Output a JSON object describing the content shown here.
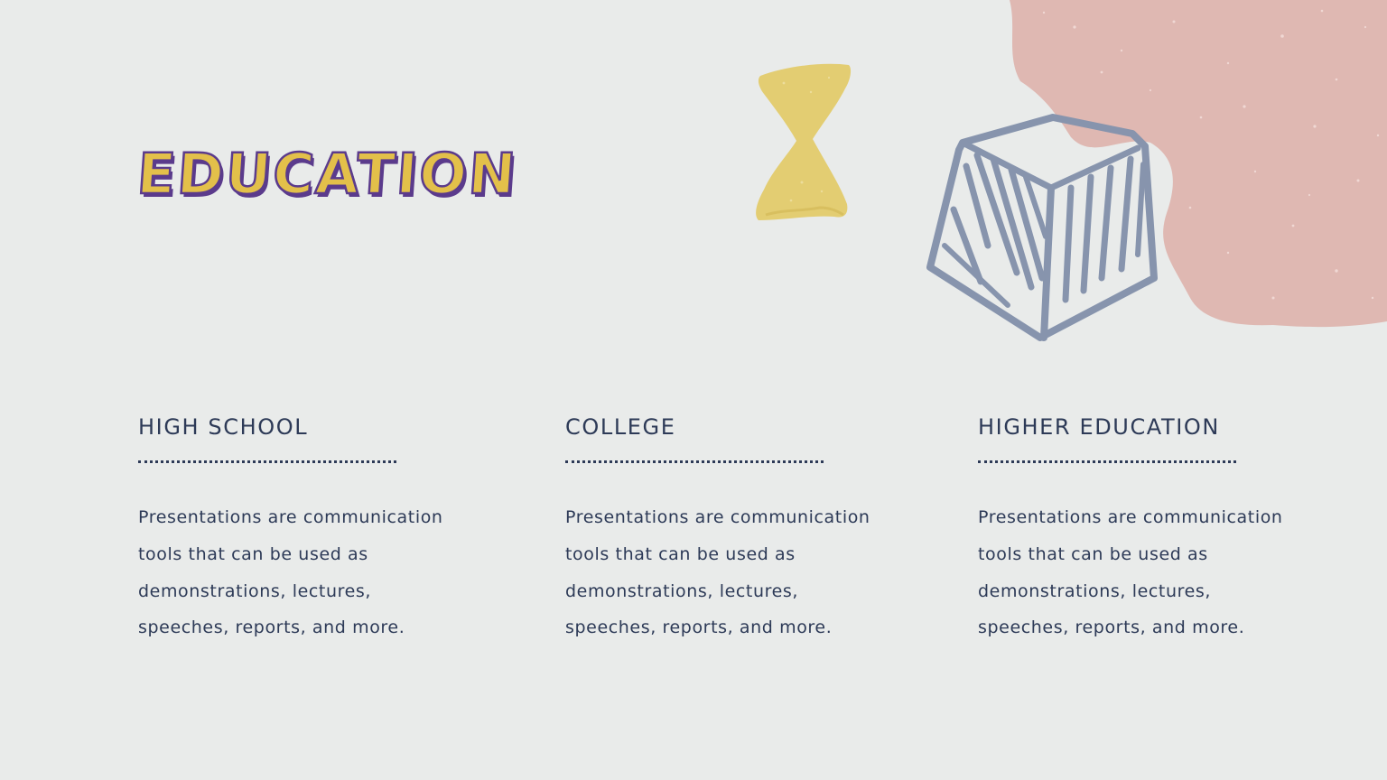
{
  "slide": {
    "title": "EDUCATION",
    "columns": [
      {
        "heading": "HIGH SCHOOL",
        "body": "Presentations are communication tools that can be used as demonstrations, lectures, speeches, reports, and more."
      },
      {
        "heading": "COLLEGE",
        "body": "Presentations are communication tools that can be used as demonstrations, lectures, speeches, reports, and more."
      },
      {
        "heading": "HIGHER EDUCATION",
        "body": "Presentations are communication tools that can be used as demonstrations, lectures, speeches, reports, and more."
      }
    ]
  },
  "decorations": [
    {
      "name": "pink-paint-blob",
      "color": "#dfb8b2"
    },
    {
      "name": "hourglass-doodle-icon",
      "color": "#e3cd72"
    },
    {
      "name": "cube-doodle-icon",
      "color": "#8794ad"
    }
  ],
  "colors": {
    "background": "#e9ebea",
    "title_fill": "#e3c04a",
    "title_outline": "#5b3b8c",
    "text": "#2d3a57"
  }
}
